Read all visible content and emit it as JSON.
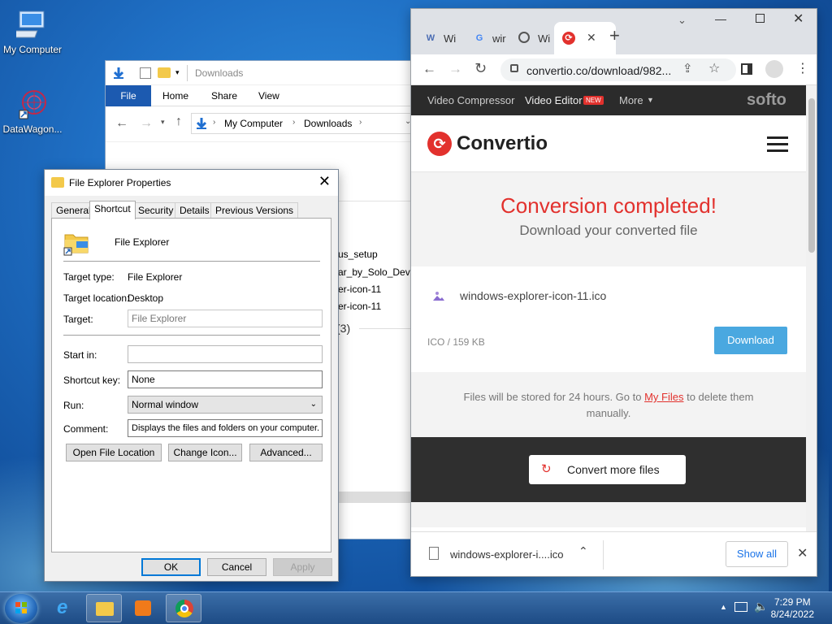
{
  "desktop": {
    "icons": [
      {
        "label": "My Computer"
      },
      {
        "label": "DataWagon..."
      }
    ]
  },
  "explorer": {
    "title": "Downloads",
    "ribbon_tabs": [
      "File",
      "Home",
      "Share",
      "View"
    ],
    "breadcrumb": [
      "My Computer",
      "Downloads"
    ],
    "file_fragments": [
      "us_setup",
      "ar_by_Solo_Dev",
      "er-icon-11",
      "er-icon-11"
    ],
    "group_count": "(3)"
  },
  "properties": {
    "title": "File Explorer Properties",
    "tabs": [
      "General",
      "Shortcut",
      "Security",
      "Details",
      "Previous Versions"
    ],
    "name": "File Explorer",
    "target_type_label": "Target type:",
    "target_type": "File Explorer",
    "target_location_label": "Target location:",
    "target_location": "Desktop",
    "target_label": "Target:",
    "target": "File Explorer",
    "start_in_label": "Start in:",
    "start_in": "",
    "shortcut_key_label": "Shortcut key:",
    "shortcut_key": "None",
    "run_label": "Run:",
    "run": "Normal window",
    "comment_label": "Comment:",
    "comment": "Displays the files and folders on your computer.",
    "btn_open_location": "Open File Location",
    "btn_change_icon": "Change Icon...",
    "btn_advanced": "Advanced...",
    "btn_ok": "OK",
    "btn_cancel": "Cancel",
    "btn_apply": "Apply"
  },
  "chrome": {
    "tabs": [
      {
        "title": "Wi",
        "icon": "W"
      },
      {
        "title": "wir",
        "icon": "G"
      },
      {
        "title": "Wi",
        "icon": "globe"
      },
      {
        "title": "",
        "icon": "convertio"
      }
    ],
    "url": "convertio.co/download/982...",
    "nav": {
      "video_compressor": "Video Compressor",
      "video_editor": "Video Editor",
      "new_badge": "NEW",
      "more": "More",
      "brand_right": "softo"
    },
    "brand": "Convertio",
    "heading": "Conversion completed!",
    "subheading": "Download your converted file",
    "file_name": "windows-explorer-icon-11.ico",
    "file_meta": "ICO / 159 KB",
    "download_label": "Download",
    "info_prefix": "Files will be stored for 24 hours. Go to ",
    "info_link": "My Files",
    "info_suffix": " to delete them manually.",
    "convert_more": "Convert more files",
    "download_bar": {
      "file": "windows-explorer-i....ico",
      "show_all": "Show all"
    }
  },
  "taskbar": {
    "time": "7:29 PM",
    "date": "8/24/2022"
  },
  "colors": {
    "convertio_red": "#e2312d",
    "download_blue": "#4aa8e0",
    "explorer_file_tab": "#1c5ab0"
  }
}
